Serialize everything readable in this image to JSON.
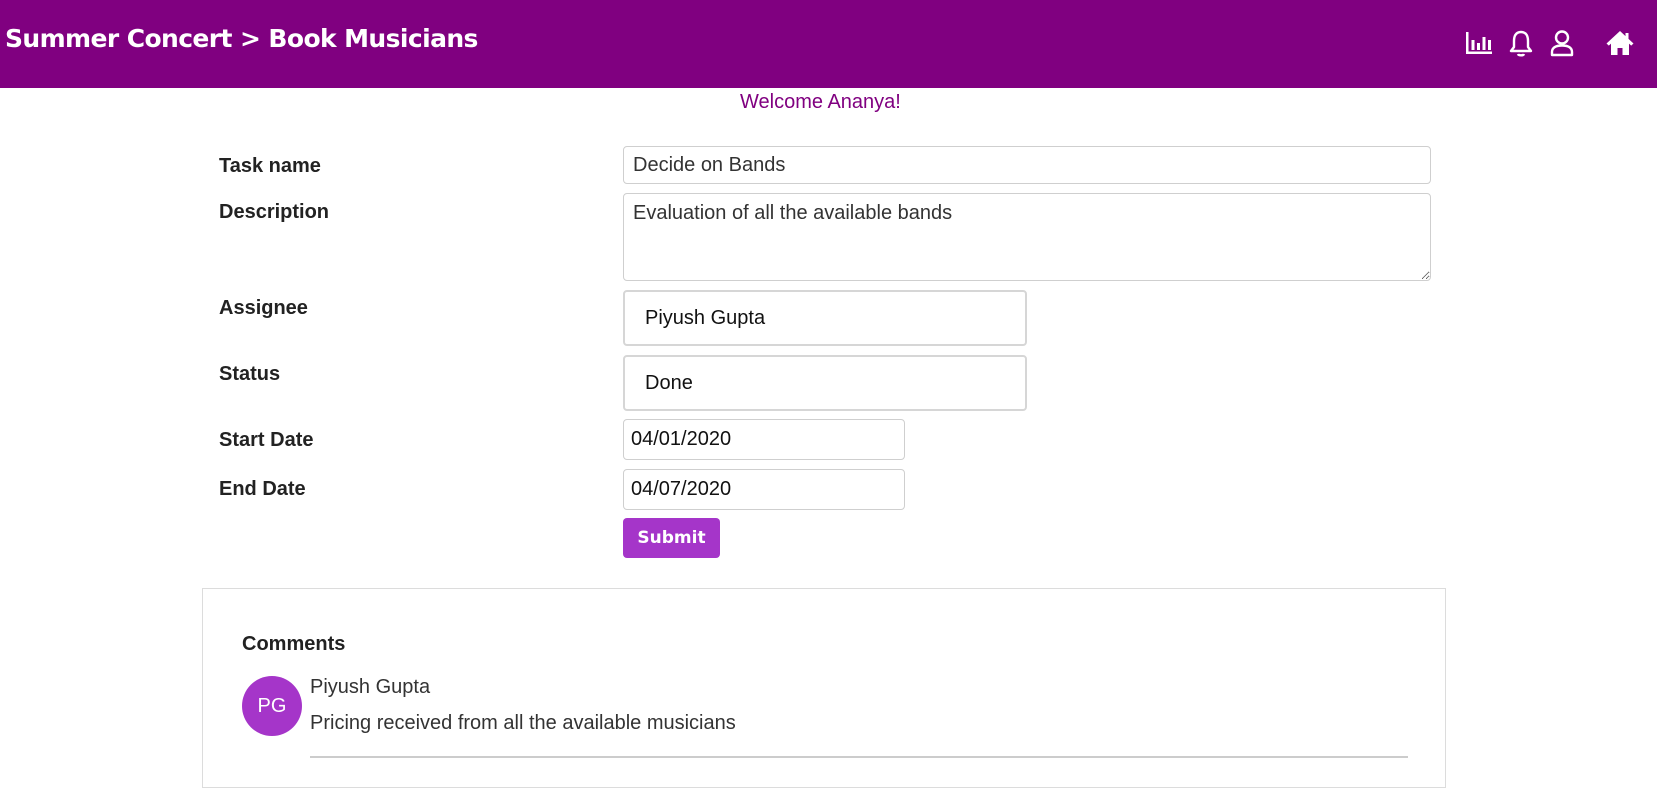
{
  "header": {
    "breadcrumb": "Summer Concert > Book Musicians",
    "icons": [
      "chart-icon",
      "bell-icon",
      "user-icon",
      "home-icon"
    ],
    "background_color": "#800080"
  },
  "welcome": "Welcome Ananya!",
  "form": {
    "task_name_label": "Task name",
    "task_name_value": "Decide on Bands",
    "description_label": "Description",
    "description_value": "Evaluation of all the available bands",
    "assignee_label": "Assignee",
    "assignee_value": "Piyush Gupta",
    "status_label": "Status",
    "status_value": "Done",
    "start_date_label": "Start Date",
    "start_date_value": "04/01/2020",
    "end_date_label": "End Date",
    "end_date_value": "04/07/2020",
    "submit_label": "Submit"
  },
  "comments": {
    "title": "Comments",
    "items": [
      {
        "initials": "PG",
        "author": "Piyush Gupta",
        "text": "Pricing received from all the available musicians"
      }
    ]
  },
  "colors": {
    "accent": "#a535c9",
    "brand": "#800080"
  }
}
